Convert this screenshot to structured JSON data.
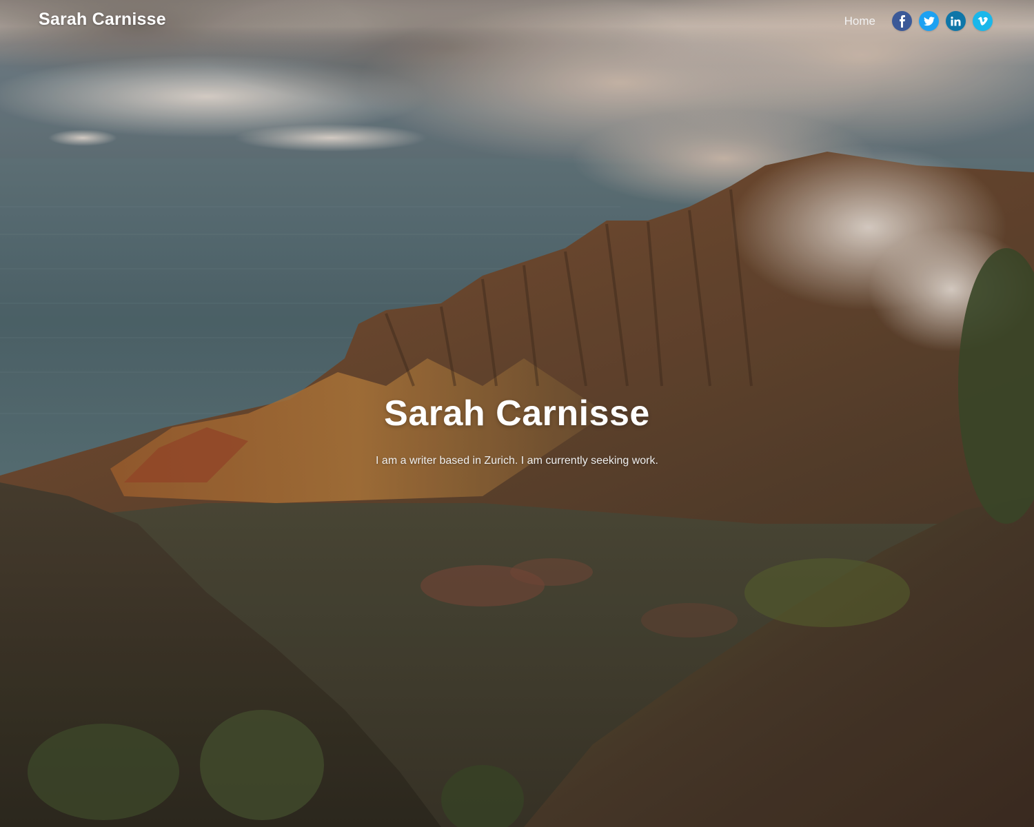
{
  "header": {
    "brand": "Sarah Carnisse",
    "nav": [
      {
        "label": "Home"
      }
    ],
    "social": [
      {
        "name": "facebook",
        "icon": "facebook-icon",
        "color": "#3b5998"
      },
      {
        "name": "twitter",
        "icon": "twitter-icon",
        "color": "#1da1f2"
      },
      {
        "name": "linkedin",
        "icon": "linkedin-icon",
        "color": "#0e76a8"
      },
      {
        "name": "vimeo",
        "icon": "vimeo-icon",
        "color": "#1ab7ea"
      }
    ]
  },
  "hero": {
    "title": "Sarah Carnisse",
    "subtitle": "I am a writer based in Zurich. I am currently seeking work."
  }
}
